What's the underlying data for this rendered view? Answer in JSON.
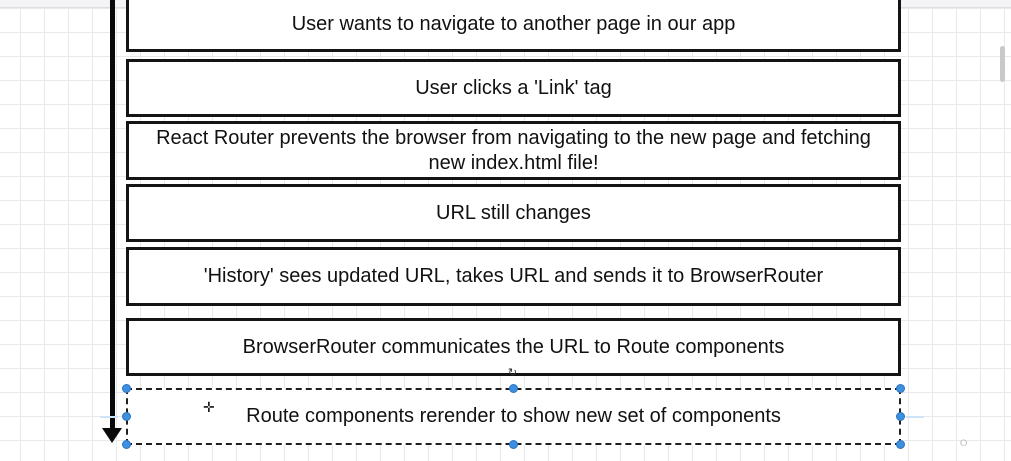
{
  "diagram": {
    "steps": [
      {
        "text": "User wants to navigate to another page in our app"
      },
      {
        "text": "User clicks a 'Link' tag"
      },
      {
        "text": "React Router prevents the browser from navigating to the new page and fetching new index.html file!"
      },
      {
        "text": "URL still changes"
      },
      {
        "text": "'History' sees updated URL, takes URL and sends it to BrowserRouter"
      },
      {
        "text": "BrowserRouter communicates the URL to Route components"
      },
      {
        "text": "Route components rerender to show new set of components"
      }
    ]
  },
  "colors": {
    "selection": "#3d8fe0",
    "box_border": "#141414",
    "arrow": "#0a0a0a"
  },
  "icons": {
    "rotate": "rotate-icon",
    "move": "move-cursor-icon",
    "logo": "udemy-logo-icon"
  }
}
